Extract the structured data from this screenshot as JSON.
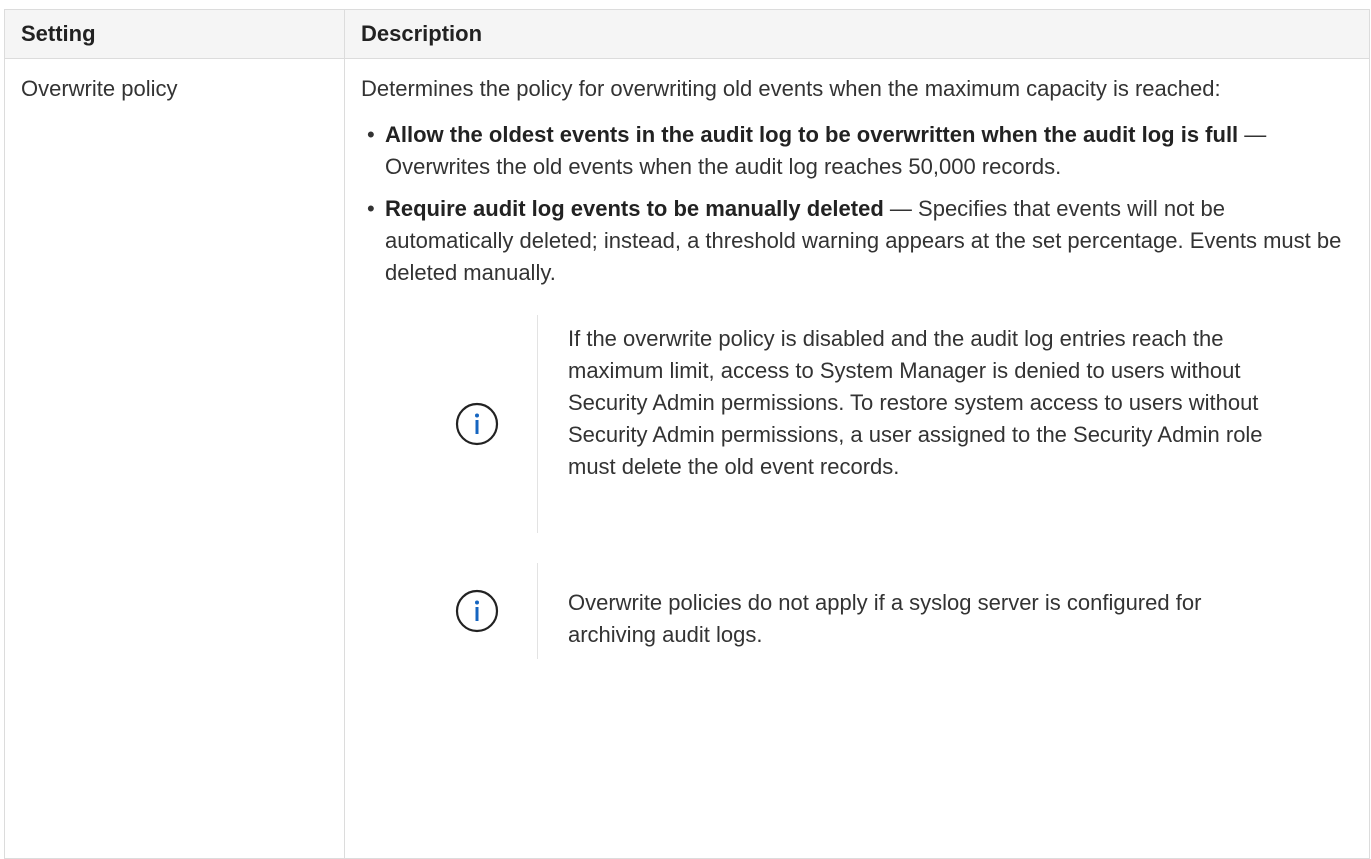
{
  "table": {
    "headers": [
      "Setting",
      "Description"
    ],
    "row": {
      "setting": "Overwrite policy",
      "intro": "Determines the policy for overwriting old events when the maximum capacity is reached:",
      "options": [
        {
          "title": "Allow the oldest events in the audit log to be overwritten when the audit log is full",
          "desc": "Overwrites the old events when the audit log reaches 50,000 records."
        },
        {
          "title": "Require audit log events to be manually deleted",
          "desc": "Specifies that events will not be automatically deleted; instead, a threshold warning appears at the set percentage. Events must be deleted manually."
        }
      ],
      "notes": [
        {
          "icon": "info-icon",
          "text": "If the overwrite policy is disabled and the audit log entries reach the maximum limit, access to System Manager is denied to users without Security Admin permissions. To restore system access to users without Security Admin permissions, a user assigned to the Security Admin role must delete the old event records."
        },
        {
          "icon": "info-icon",
          "text": "Overwrite policies do not apply if a syslog server is configured for archiving audit logs."
        }
      ]
    }
  },
  "colors": {
    "info_icon": "#1565c0",
    "header_bg": "#f5f5f5",
    "border": "#dcdcdc"
  },
  "separator": "—",
  "bullet": "•"
}
